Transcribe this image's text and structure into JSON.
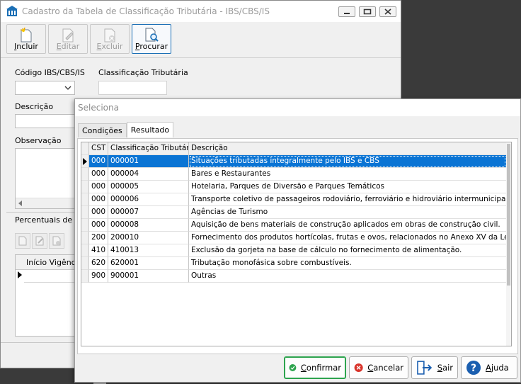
{
  "main_window": {
    "title": "Cadastro da Tabela de Classificação Tributária - IBS/CBS/IS",
    "toolbar": [
      {
        "label_ul": "I",
        "label_rest": "ncluir",
        "state": "enabled"
      },
      {
        "label_ul": "E",
        "label_rest": "ditar",
        "state": "disabled"
      },
      {
        "label_ul": "E",
        "label_rest": "xcluir",
        "state": "disabled"
      },
      {
        "label_ul": "P",
        "label_rest": "rocurar",
        "state": "active"
      }
    ],
    "labels": {
      "codigo": "Código IBS/CBS/IS",
      "classificacao": "Classificação Tributária",
      "descricao": "Descrição",
      "observacao": "Observação",
      "percentuais": "Percentuais de R",
      "inicio_vigencia": "Início Vigênci"
    }
  },
  "dialog": {
    "title": "Seleciona",
    "tabs": [
      "Condições",
      "Resultado"
    ],
    "active_tab": "Resultado",
    "columns": [
      "CST",
      "Classificação Tributária",
      "Descrição"
    ],
    "rows": [
      {
        "cst": "000",
        "classificacao": "000001",
        "descricao": "Situações tributadas integralmente pelo IBS e CBS"
      },
      {
        "cst": "000",
        "classificacao": "000004",
        "descricao": "Bares e Restaurantes"
      },
      {
        "cst": "000",
        "classificacao": "000005",
        "descricao": "Hotelaria, Parques de Diversão e Parques Temáticos"
      },
      {
        "cst": "000",
        "classificacao": "000006",
        "descricao": "Transporte coletivo de passageiros rodoviário, ferroviário e hidroviário intermunicipais e inter"
      },
      {
        "cst": "000",
        "classificacao": "000007",
        "descricao": "Agências de Turismo"
      },
      {
        "cst": "000",
        "classificacao": "000008",
        "descricao": "Aquisição de bens materiais de construção aplicados em obras de construção civil."
      },
      {
        "cst": "200",
        "classificacao": "200010",
        "descricao": "Fornecimento dos produtos hortícolas, frutas e ovos, relacionados no Anexo XV da Lei Comp"
      },
      {
        "cst": "410",
        "classificacao": "410013",
        "descricao": "Exclusão da gorjeta na base de cálculo no fornecimento de alimentação."
      },
      {
        "cst": "620",
        "classificacao": "620001",
        "descricao": "Tributação monofásica sobre combustíveis."
      },
      {
        "cst": "900",
        "classificacao": "900001",
        "descricao": "Outras"
      }
    ],
    "selected_row": 0,
    "buttons": {
      "confirmar": {
        "ul": "C",
        "rest": "onfirmar"
      },
      "cancelar": {
        "ul": "C",
        "rest": "ancelar"
      },
      "sair": {
        "ul": "S",
        "rest": "air"
      },
      "ajuda": {
        "ul": "A",
        "rest": "juda"
      }
    }
  },
  "colors": {
    "selection": "#0a74d4",
    "confirm_green": "#2da44e",
    "cancel_red": "#d9342b",
    "help_blue": "#1b5fb0"
  }
}
